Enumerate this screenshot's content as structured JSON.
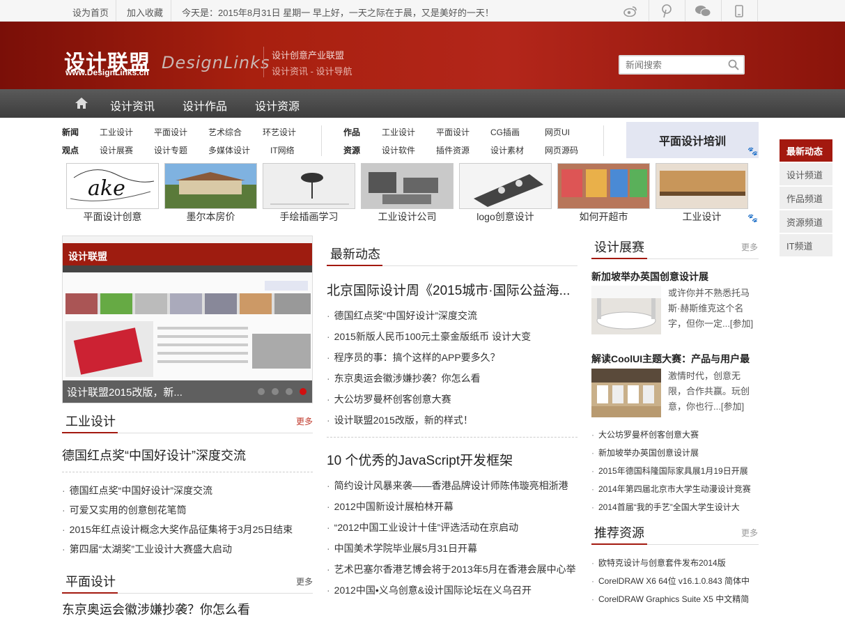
{
  "topbar": {
    "set_home": "设为首页",
    "bookmark": "加入收藏",
    "greeting": "今天是：2015年8月31日 星期一 早上好，一天之际在于晨，又是美好的一天！"
  },
  "header": {
    "logo_cn": "设计联盟",
    "logo_url": "www.DesignLinks.cn",
    "logo_en": "DesignLinks",
    "slogan1": "设计创意产业联盟",
    "slogan2": "设计资讯 - 设计导航",
    "search_placeholder": "新闻搜索"
  },
  "nav": [
    "设计资讯",
    "设计作品",
    "设计资源"
  ],
  "categories": {
    "row1_left_head": "新闻",
    "row1_left": [
      "工业设计",
      "平面设计",
      "艺术综合",
      "环艺设计"
    ],
    "row2_left_head": "观点",
    "row2_left": [
      "设计展赛",
      "设计专题",
      "多媒体设计",
      "IT网络"
    ],
    "row1_right_head": "作品",
    "row1_right": [
      "工业设计",
      "平面设计",
      "CG插画",
      "网页UI"
    ],
    "row2_right_head": "资源",
    "row2_right": [
      "设计软件",
      "插件资源",
      "设计素材",
      "网页源码"
    ]
  },
  "promo": "平面设计培训",
  "thumbs": [
    "平面设计创意",
    "墨尔本房价",
    "手绘插画学习",
    "工业设计公司",
    "logo创意设计",
    "如何开超市",
    "工业设计"
  ],
  "right_side": [
    "最新动态",
    "设计频道",
    "作品频道",
    "资源频道",
    "IT频道"
  ],
  "slide": {
    "caption": "设计联盟2015改版，新..."
  },
  "left": {
    "sec1_title": "工业设计",
    "more": "更多",
    "sec1_headline": "德国红点奖“中国好设计”深度交流",
    "sec1_list": [
      "德国红点奖“中国好设计”深度交流",
      "可爱又实用的创意刨花笔筒",
      "2015年红点设计概念大奖作品征集将于3月25日结束",
      "第四届“太湖奖”工业设计大赛盛大启动"
    ],
    "sec2_title": "平面设计",
    "sec2_headline": "东京奥运会徽涉嫌抄袭？你怎么看"
  },
  "middle": {
    "title": "最新动态",
    "headline1": "北京国际设计周《2015城市·国际公益海...",
    "list1": [
      "德国红点奖“中国好设计”深度交流",
      "2015新版人民币100元土豪金版纸币 设计大变",
      "程序员的事：搞个这样的APP要多久？",
      "东京奥运会徽涉嫌抄袭？你怎么看",
      "大公坊罗曼杯创客创意大赛",
      "设计联盟2015改版，新的样式！"
    ],
    "headline2": "10 个优秀的JavaScript开发框架",
    "list2": [
      "简约设计风暴来袭——香港品牌设计师陈伟璇亮相浙港",
      "2012中国新设计展柏林开幕",
      "“2012中国工业设计十佳”评选活动在京启动",
      "中国美术学院毕业展5月31日开幕",
      "艺术巴塞尔香港艺博会将于2013年5月在香港会展中心举",
      "2012中国•义乌创意&设计国际论坛在义乌召开"
    ]
  },
  "rightcol": {
    "title": "设计展赛",
    "more": "更多",
    "item1_title": "新加坡举办英国创意设计展",
    "item1_text": "或许你并不熟悉托马斯·赫斯维克这个名字，但你一定...[参加]",
    "item2_title": "解读CoolUI主题大赛：产品与用户最",
    "item2_text": "激情时代，创意无限，合作共赢。玩创意，你也行...[参加]",
    "list": [
      "大公坊罗曼杯创客创意大赛",
      "新加坡举办英国创意设计展",
      "2015年德国科隆国际家具展1月19日开展",
      "2014年第四届北京市大学生动漫设计竞赛",
      "2014首届“我的手艺”全国大学生设计大"
    ],
    "res_title": "推荐资源",
    "res_list": [
      "欧特克设计与创意套件发布2014版",
      "CorelDRAW X6 64位 v16.1.0.843 简体中",
      "CorelDRAW Graphics Suite X5 中文精简"
    ]
  },
  "colors": {
    "brand_red": "#a3190f",
    "nav_dark": "#444444",
    "more_red": "#c0392b"
  }
}
